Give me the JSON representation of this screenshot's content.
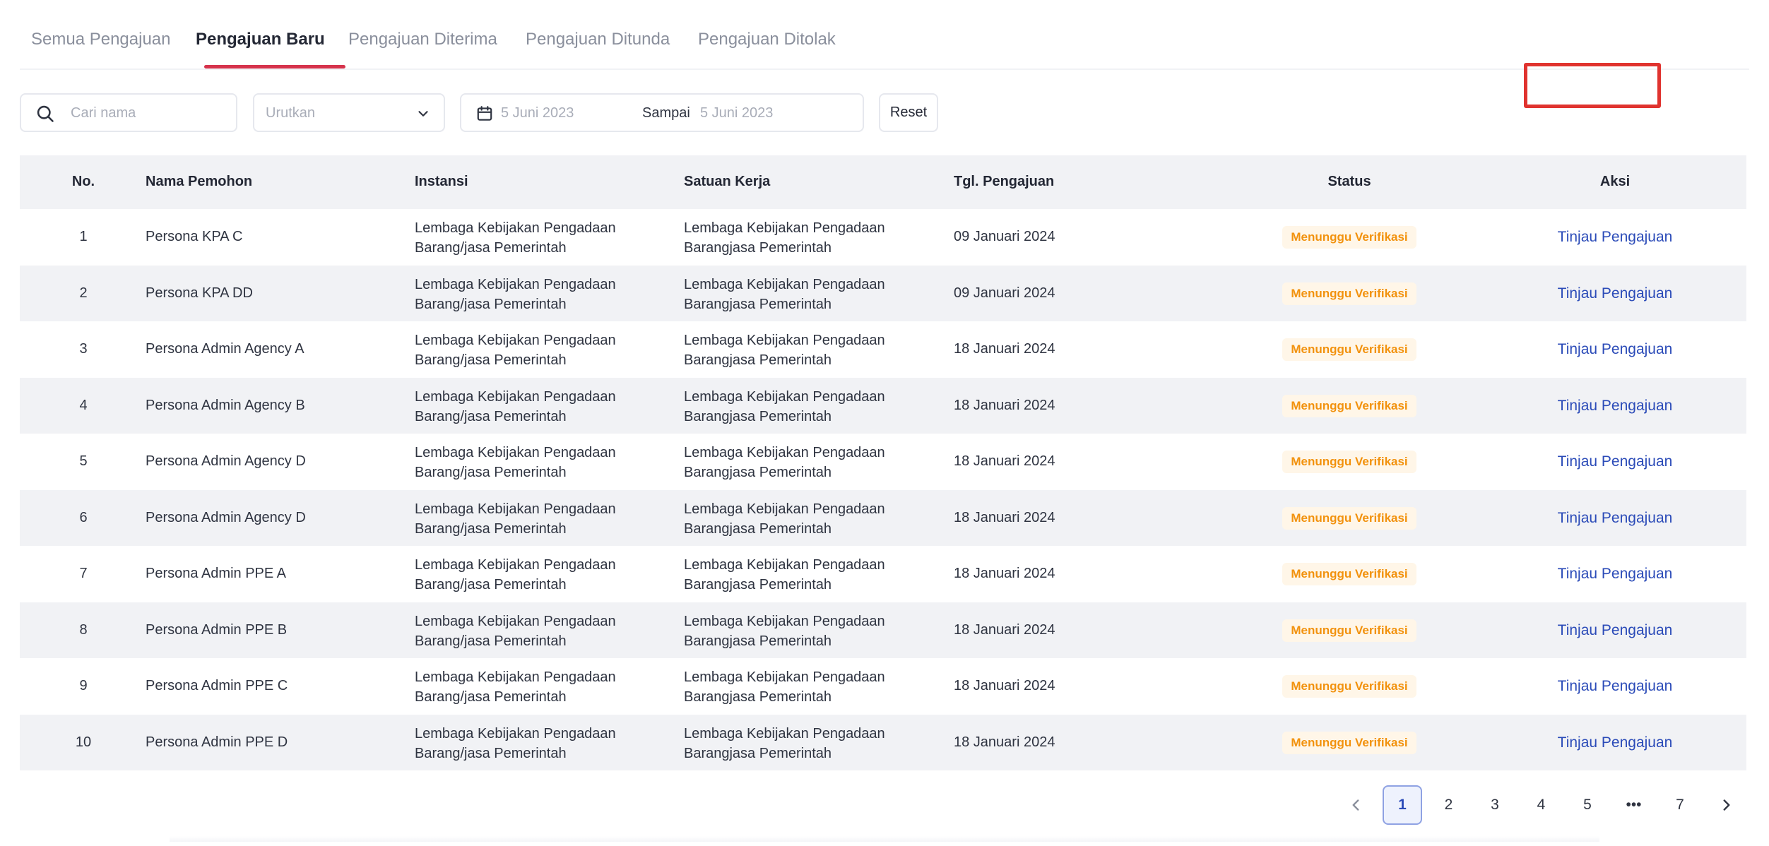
{
  "tabs": [
    {
      "label": "Semua Pengajuan"
    },
    {
      "label": "Pengajuan Baru"
    },
    {
      "label": "Pengajuan Diterima"
    },
    {
      "label": "Pengajuan Ditunda"
    },
    {
      "label": "Pengajuan Ditolak"
    }
  ],
  "filters": {
    "search_placeholder": "Cari nama",
    "sort_placeholder": "Urutkan",
    "date_from": "5 Juni 2023",
    "date_separator": "Sampai",
    "date_to": "5 Juni 2023",
    "reset_label": "Reset"
  },
  "table": {
    "headers": [
      "No.",
      "Nama Pemohon",
      "Instansi",
      "Satuan Kerja",
      "Tgl. Pengajuan",
      "Status",
      "Aksi"
    ],
    "rows": [
      {
        "no": "1",
        "name": "Persona KPA C",
        "inst1": "Lembaga Kebijakan Pengadaan",
        "inst2": "Barang/jasa Pemerintah",
        "unit1": "Lembaga Kebijakan Pengadaan",
        "unit2": "Barangjasa Pemerintah",
        "date": "09 Januari 2024",
        "status": "Menunggu Verifikasi",
        "action": "Tinjau Pengajuan"
      },
      {
        "no": "2",
        "name": "Persona KPA DD",
        "inst1": "Lembaga Kebijakan Pengadaan",
        "inst2": "Barang/jasa Pemerintah",
        "unit1": "Lembaga Kebijakan Pengadaan",
        "unit2": "Barangjasa Pemerintah",
        "date": "09 Januari 2024",
        "status": "Menunggu Verifikasi",
        "action": "Tinjau Pengajuan"
      },
      {
        "no": "3",
        "name": "Persona Admin Agency A",
        "inst1": "Lembaga Kebijakan Pengadaan",
        "inst2": "Barang/jasa Pemerintah",
        "unit1": "Lembaga Kebijakan Pengadaan",
        "unit2": "Barangjasa Pemerintah",
        "date": "18 Januari 2024",
        "status": "Menunggu Verifikasi",
        "action": "Tinjau Pengajuan"
      },
      {
        "no": "4",
        "name": "Persona Admin Agency B",
        "inst1": "Lembaga Kebijakan Pengadaan",
        "inst2": "Barang/jasa Pemerintah",
        "unit1": "Lembaga Kebijakan Pengadaan",
        "unit2": "Barangjasa Pemerintah",
        "date": "18 Januari 2024",
        "status": "Menunggu Verifikasi",
        "action": "Tinjau Pengajuan"
      },
      {
        "no": "5",
        "name": "Persona Admin Agency D",
        "inst1": "Lembaga Kebijakan Pengadaan",
        "inst2": "Barang/jasa Pemerintah",
        "unit1": "Lembaga Kebijakan Pengadaan",
        "unit2": "Barangjasa Pemerintah",
        "date": "18 Januari 2024",
        "status": "Menunggu Verifikasi",
        "action": "Tinjau Pengajuan"
      },
      {
        "no": "6",
        "name": "Persona Admin Agency D",
        "inst1": "Lembaga Kebijakan Pengadaan",
        "inst2": "Barang/jasa Pemerintah",
        "unit1": "Lembaga Kebijakan Pengadaan",
        "unit2": "Barangjasa Pemerintah",
        "date": "18 Januari 2024",
        "status": "Menunggu Verifikasi",
        "action": "Tinjau Pengajuan"
      },
      {
        "no": "7",
        "name": "Persona Admin PPE A",
        "inst1": "Lembaga Kebijakan Pengadaan",
        "inst2": "Barang/jasa Pemerintah",
        "unit1": "Lembaga Kebijakan Pengadaan",
        "unit2": "Barangjasa Pemerintah",
        "date": "18 Januari 2024",
        "status": "Menunggu Verifikasi",
        "action": "Tinjau Pengajuan"
      },
      {
        "no": "8",
        "name": "Persona Admin PPE B",
        "inst1": "Lembaga Kebijakan Pengadaan",
        "inst2": "Barang/jasa Pemerintah",
        "unit1": "Lembaga Kebijakan Pengadaan",
        "unit2": "Barangjasa Pemerintah",
        "date": "18 Januari 2024",
        "status": "Menunggu Verifikasi",
        "action": "Tinjau Pengajuan"
      },
      {
        "no": "9",
        "name": "Persona Admin PPE C",
        "inst1": "Lembaga Kebijakan Pengadaan",
        "inst2": "Barang/jasa Pemerintah",
        "unit1": "Lembaga Kebijakan Pengadaan",
        "unit2": "Barangjasa Pemerintah",
        "date": "18 Januari 2024",
        "status": "Menunggu Verifikasi",
        "action": "Tinjau Pengajuan"
      },
      {
        "no": "10",
        "name": "Persona Admin PPE D",
        "inst1": "Lembaga Kebijakan Pengadaan",
        "inst2": "Barang/jasa Pemerintah",
        "unit1": "Lembaga Kebijakan Pengadaan",
        "unit2": "Barangjasa Pemerintah",
        "date": "18 Januari 2024",
        "status": "Menunggu Verifikasi",
        "action": "Tinjau Pengajuan"
      }
    ]
  },
  "pagination": {
    "pages": [
      "1",
      "2",
      "3",
      "4",
      "5",
      "•••",
      "7"
    ],
    "current": "1"
  },
  "colors": {
    "active_tab_underline": "#d6334c",
    "status_badge_text": "#f2920e",
    "action_link": "#2b4bb8",
    "highlight_box": "#e0332f"
  }
}
